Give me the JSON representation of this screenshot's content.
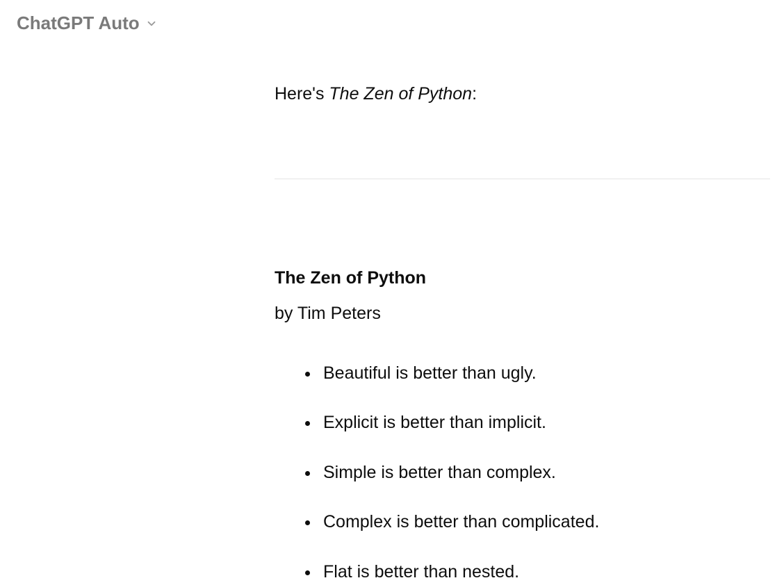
{
  "header": {
    "model_label": "ChatGPT Auto"
  },
  "message": {
    "intro_prefix": "Here's ",
    "intro_italic": "The Zen of Python",
    "intro_suffix": ":",
    "title": "The Zen of Python",
    "byline": "by Tim Peters",
    "items": [
      "Beautiful is better than ugly.",
      "Explicit is better than implicit.",
      "Simple is better than complex.",
      "Complex is better than complicated.",
      "Flat is better than nested."
    ]
  }
}
